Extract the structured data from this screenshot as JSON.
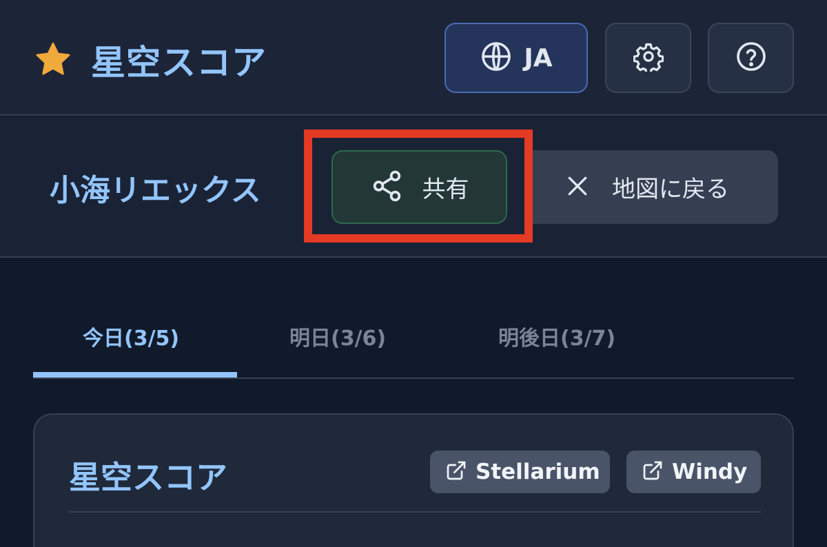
{
  "header": {
    "title": "星空スコア",
    "language_label": "JA",
    "icons": {
      "brand": "star-icon",
      "language": "globe-icon",
      "settings": "gear-icon",
      "help": "help-circle-icon"
    }
  },
  "location": {
    "name": "小海リエックス",
    "share_label": "共有",
    "back_label": "地図に戻る"
  },
  "tabs": [
    {
      "label": "今日(3/5)",
      "active": true
    },
    {
      "label": "明日(3/6)",
      "active": false
    },
    {
      "label": "明後日(3/7)",
      "active": false
    }
  ],
  "card": {
    "title": "星空スコア",
    "links": [
      {
        "label": "Stellarium",
        "icon": "external-link-icon"
      },
      {
        "label": "Windy",
        "icon": "external-link-icon"
      }
    ]
  },
  "colors": {
    "accent": "#93c5fd",
    "star": "#f0a93b",
    "highlight": "#e53a24"
  }
}
